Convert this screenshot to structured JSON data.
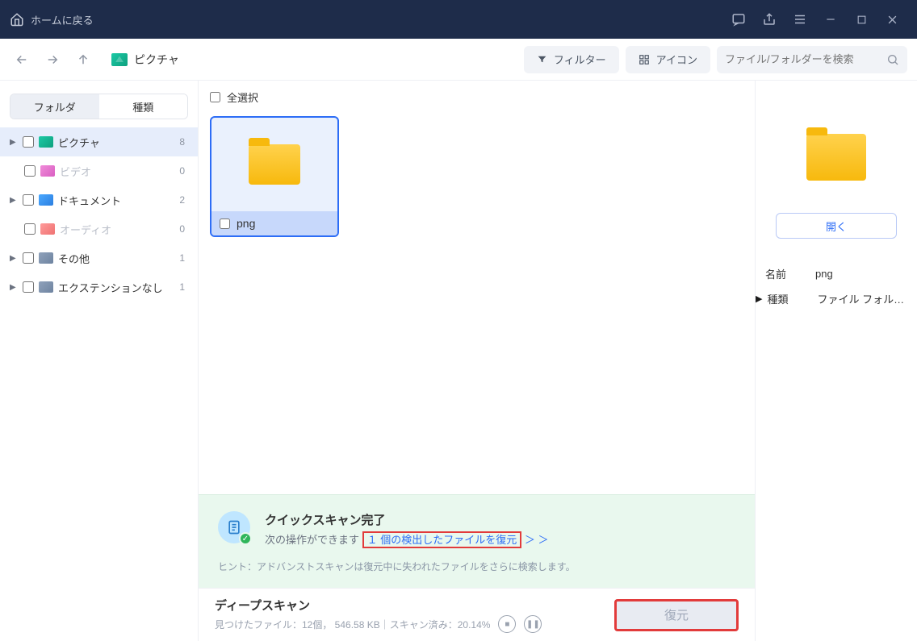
{
  "titlebar": {
    "home_label": "ホームに戻る"
  },
  "toolbar": {
    "breadcrumb_label": "ピクチャ",
    "filter_label": "フィルター",
    "view_label": "アイコン",
    "search_placeholder": "ファイル/フォルダーを検索"
  },
  "sidebar": {
    "tab_folder": "フォルダ",
    "tab_type": "種類",
    "items": [
      {
        "label": "ピクチャ",
        "count": "8",
        "icon": "fi-pic",
        "active": true,
        "expandable": true
      },
      {
        "label": "ビデオ",
        "count": "0",
        "icon": "fi-vid",
        "muted": true,
        "indent": true
      },
      {
        "label": "ドキュメント",
        "count": "2",
        "icon": "fi-doc",
        "expandable": true
      },
      {
        "label": "オーディオ",
        "count": "0",
        "icon": "fi-aud",
        "muted": true,
        "indent": true
      },
      {
        "label": "その他",
        "count": "1",
        "icon": "fi-oth",
        "expandable": true
      },
      {
        "label": "エクステンションなし",
        "count": "1",
        "icon": "fi-ext",
        "expandable": true
      }
    ]
  },
  "content": {
    "select_all": "全選択",
    "item_label": "png"
  },
  "quickscan": {
    "title": "クイックスキャン完了",
    "sub_prefix": "次の操作ができます",
    "link": "１ 個の検出したファイルを復元",
    "link_suffix": "＞ ＞",
    "hint": "ヒント：アドバンストスキャンは復元中に失われたファイルをさらに検索します。"
  },
  "deepscan": {
    "title": "ディープスキャン",
    "stats": "見つけたファイル：12個， 546.58 KB｜スキャン済み：20.14%",
    "recover": "復元"
  },
  "details": {
    "open": "開く",
    "name_key": "名前",
    "name_val": "png",
    "type_key": "種類",
    "type_val": "ファイル フォルダー"
  }
}
